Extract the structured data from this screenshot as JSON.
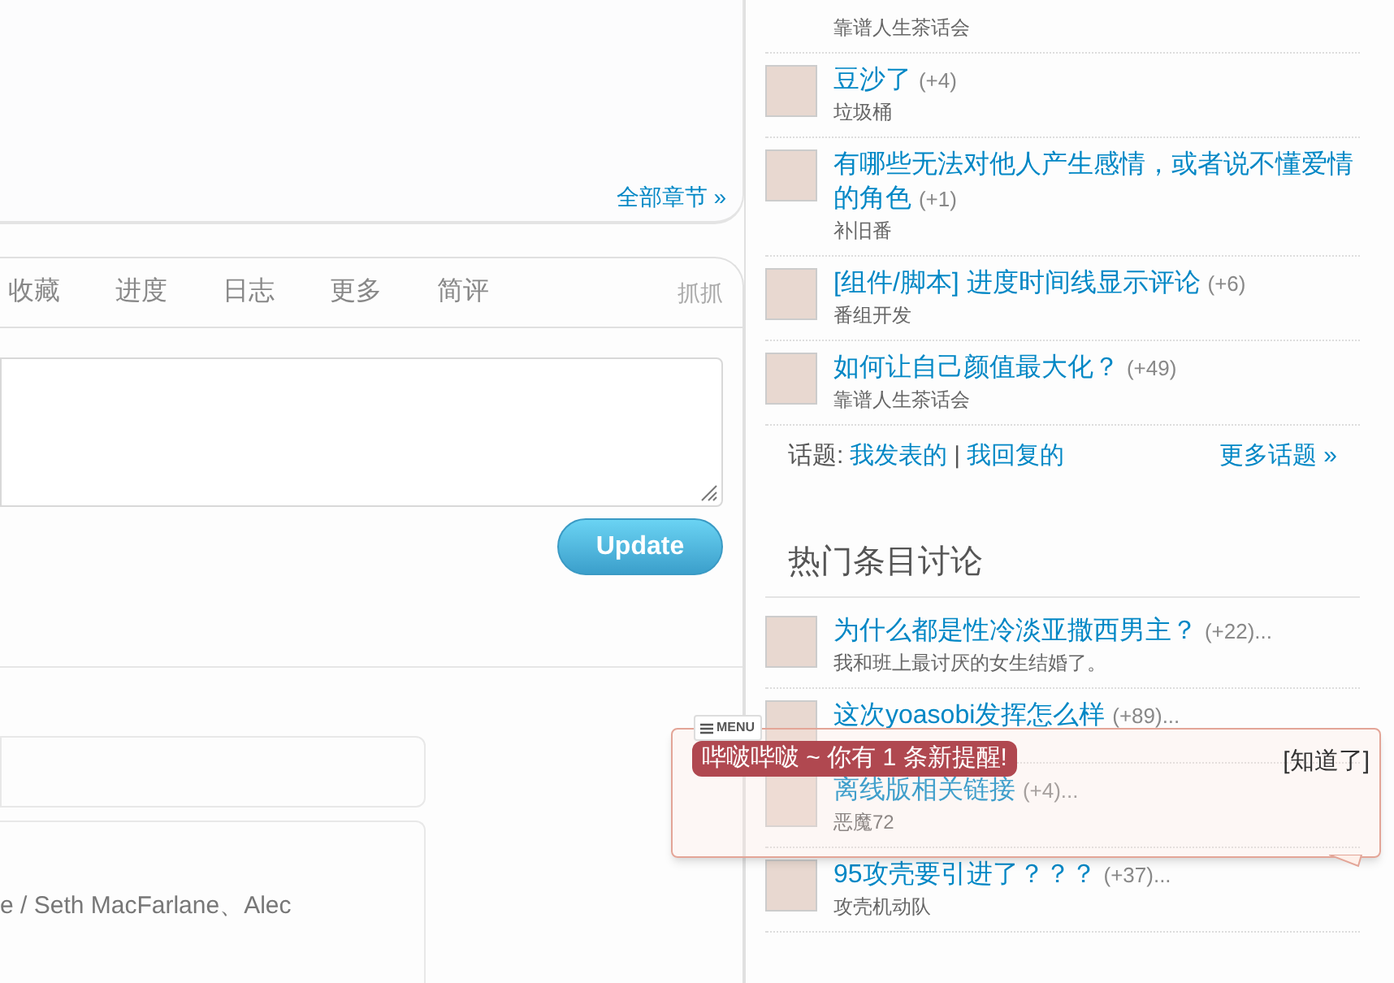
{
  "chapters_link": "全部章节 »",
  "tabs": [
    {
      "label": "收藏",
      "kind": "tab",
      "selected": false
    },
    {
      "label": "进度",
      "kind": "tab",
      "selected": false
    },
    {
      "label": "日志",
      "kind": "tab",
      "selected": false
    },
    {
      "label": "更多",
      "kind": "tab",
      "selected": false
    },
    {
      "label": "简评",
      "kind": "tab",
      "selected": false
    },
    {
      "label": "抓抓",
      "kind": "aside",
      "selected": false
    }
  ],
  "update_button": "Update",
  "credits_text": "e / Seth MacFarlane、Alec",
  "group_topics": {
    "items": [
      {
        "group": "靠谱人生茶话会"
      },
      {
        "title": "豆沙了",
        "count": "(+4)",
        "group": "垃圾桶"
      },
      {
        "title": "有哪些无法对他人产生感情，或者说不懂爱情的角色",
        "count": "(+1)",
        "group": "补旧番"
      },
      {
        "title": "[组件/脚本] 进度时间线显示评论",
        "count": "(+6)",
        "group": "番组开发"
      },
      {
        "title": "如何让自己颜值最大化？",
        "count": "(+49)",
        "group": "靠谱人生茶话会"
      }
    ],
    "footer": {
      "label": "话题:",
      "links": [
        "我发表的",
        "我回复的"
      ],
      "separator": "|",
      "more": "更多话题 »"
    }
  },
  "hot_subjects": {
    "title": "热门条目讨论",
    "items": [
      {
        "title": "为什么都是性冷淡亚撒西男主？",
        "count": "(+22)...",
        "group": "我和班上最讨厌的女生结婚了。"
      },
      {
        "title": "这次yoasobi发挥怎么样",
        "count": "(+89)..."
      },
      {
        "title": "离线版相关链接",
        "count": "(+4)...",
        "group": "恶魔72"
      },
      {
        "title": "95攻壳要引进了？？？",
        "count": "(+37)...",
        "group": "攻壳机动队"
      }
    ]
  },
  "notification": {
    "menu": "MENU",
    "message": "哔啵哔啵 ~ 你有 1 条新提醒!",
    "dismiss": "[知道了]"
  }
}
